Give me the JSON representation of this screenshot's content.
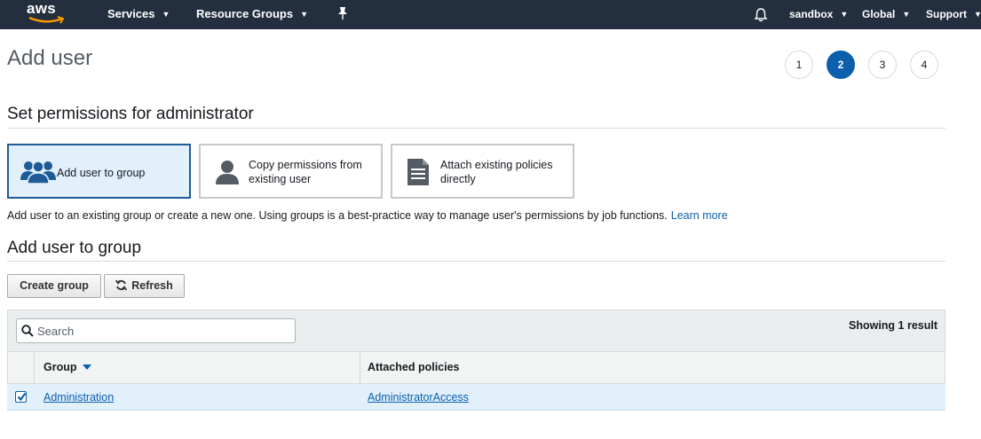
{
  "nav": {
    "logo": "aws",
    "services": "Services",
    "resource_groups": "Resource Groups",
    "account": "sandbox",
    "region": "Global",
    "support": "Support"
  },
  "page": {
    "title": "Add user"
  },
  "steps": [
    "1",
    "2",
    "3",
    "4"
  ],
  "active_step": "2",
  "permissions": {
    "heading": "Set permissions for administrator",
    "options": [
      {
        "label_line1": "Add user to group",
        "label_line2": "",
        "icon": "users-group-icon",
        "selected": true
      },
      {
        "label_line1": "Copy permissions from",
        "label_line2": "existing user",
        "icon": "user-icon",
        "selected": false
      },
      {
        "label_line1": "Attach existing policies",
        "label_line2": "directly",
        "icon": "document-icon",
        "selected": false
      }
    ],
    "description": "Add user to an existing group or create a new one. Using groups is a best-practice way to manage user's permissions by job functions.",
    "learn_more": "Learn more"
  },
  "group_section": {
    "heading": "Add user to group",
    "create_group": "Create group",
    "refresh": "Refresh"
  },
  "table": {
    "search_placeholder": "Search",
    "showing": "Showing 1 result",
    "columns": [
      "Group",
      "Attached policies"
    ],
    "rows": [
      {
        "checked": true,
        "group": "Administration",
        "policies": "AdministratorAccess"
      }
    ]
  },
  "colors": {
    "nav_bg": "#232f3e",
    "accent": "#0b5fad",
    "selected_bg": "#e1f0fb"
  }
}
